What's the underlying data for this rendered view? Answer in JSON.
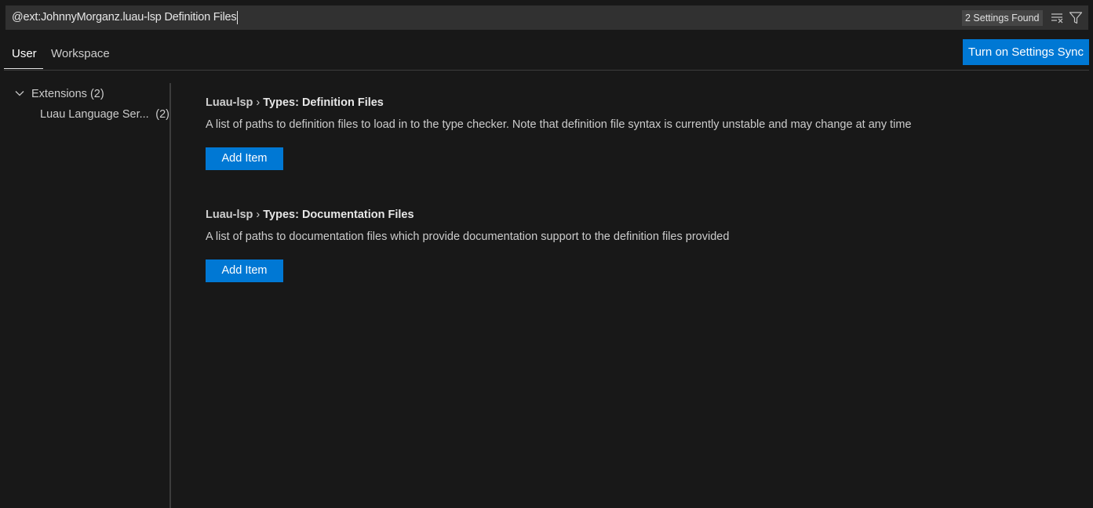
{
  "search": {
    "value": "@ext:JohnnyMorganz.luau-lsp Definition Files",
    "count_label": "2 Settings Found",
    "clear_icon": "clear-filter-icon",
    "filter_icon": "filter-icon"
  },
  "tabs": [
    {
      "label": "User",
      "active": true
    },
    {
      "label": "Workspace",
      "active": false
    }
  ],
  "sync_button": {
    "label": "Turn on Settings Sync"
  },
  "toc": {
    "group": {
      "label": "Extensions",
      "count": "(2)",
      "expanded": true
    },
    "items": [
      {
        "label": "Luau Language Ser...",
        "count": "(2)"
      }
    ]
  },
  "settings": [
    {
      "category": "Luau-lsp",
      "separator": "›",
      "name": "Types: Definition Files",
      "description": "A list of paths to definition files to load in to the type checker. Note that definition file syntax is currently unstable and may change at any time",
      "button_label": "Add Item"
    },
    {
      "category": "Luau-lsp",
      "separator": "›",
      "name": "Types: Documentation Files",
      "description": "A list of paths to documentation files which provide documentation support to the definition files provided",
      "button_label": "Add Item"
    }
  ],
  "colors": {
    "background": "#181818",
    "accent": "#0078d4",
    "input_background": "#313131",
    "divider": "#3c3c3c"
  }
}
